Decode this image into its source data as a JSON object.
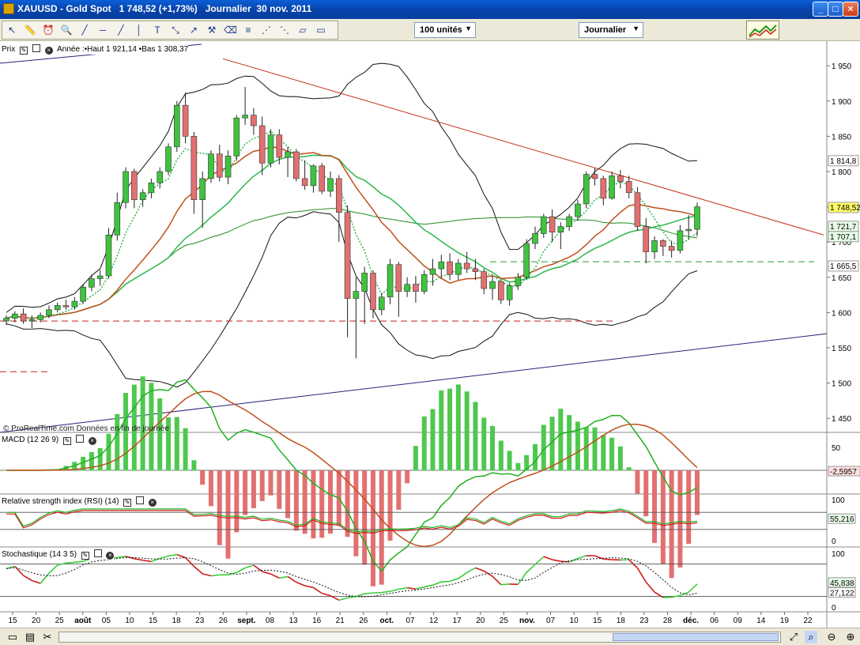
{
  "window": {
    "title": "XAUUSD - Gold Spot   1 748,52 (+1,73%)   Journalier  30 nov. 2011",
    "min_label": "_",
    "max_label": "□",
    "close_label": "×"
  },
  "toolbar": {
    "icons": [
      "cursor-icon",
      "ruler-icon",
      "alarm-icon",
      "zoom-icon",
      "line-icon",
      "horizontal-line-icon",
      "trendline-icon",
      "vertical-line-icon",
      "text-icon",
      "expand-icon",
      "arrow-icon",
      "measure-icon",
      "eraser-icon",
      "fibonacci-icon",
      "fan-icon",
      "gann-icon",
      "channel-icon",
      "rectangle-icon"
    ],
    "units_select": "100 unités",
    "period_select": "Journalier"
  },
  "panels": {
    "price": {
      "label": "Prix",
      "info": "Année :•Haut 1 921,14 •Bas 1 308,37"
    },
    "macd": {
      "label": "MACD (12 26 9)"
    },
    "rsi": {
      "label": "Relative strength index (RSI) (14)"
    },
    "stoch": {
      "label": "Stochastique (14 3 5)"
    }
  },
  "watermark": "© ProRealTime.com  Données en fin de journée",
  "axis": {
    "price_ticks": [
      "1 950",
      "1 900",
      "1 850",
      "1 800",
      "1 750",
      "1 700",
      "1 650",
      "1 600",
      "1 550",
      "1 500",
      "1 450"
    ],
    "price_tags": [
      {
        "label": "1 814,8",
        "color": "#ffffff"
      },
      {
        "label": "1 748,52",
        "color": "#ffff66"
      },
      {
        "label": "1 721,7",
        "color": "#e8ffe8"
      },
      {
        "label": "1 707,1",
        "color": "#e8ffe8"
      },
      {
        "label": "1 665,5",
        "color": "#ffffff"
      }
    ],
    "macd_ticks": [
      "50"
    ],
    "macd_tag": "-2,5957",
    "rsi_ticks": [
      "100",
      "0"
    ],
    "rsi_tag": "55,216",
    "stoch_ticks": [
      "100",
      "0"
    ],
    "stoch_tags": [
      "45,838",
      "27,122"
    ],
    "dates": [
      "15",
      "20",
      "25",
      "août",
      "05",
      "10",
      "15",
      "18",
      "23",
      "26",
      "sept.",
      "08",
      "13",
      "16",
      "21",
      "26",
      "oct.",
      "07",
      "12",
      "17",
      "20",
      "25",
      "nov.",
      "07",
      "10",
      "15",
      "18",
      "23",
      "28",
      "déc.",
      "06",
      "09",
      "14",
      "19",
      "22"
    ]
  },
  "chart_data": {
    "type": "candlestick",
    "title": "XAUUSD - Gold Spot",
    "period": "Journalier",
    "ylim": [
      1430,
      1985
    ],
    "last_close": 1748.52,
    "change_pct": "+1,73%",
    "year_high": 1921.14,
    "year_low": 1308.37,
    "candles": [
      [
        1588,
        1596,
        1582,
        1592
      ],
      [
        1592,
        1602,
        1586,
        1598
      ],
      [
        1598,
        1606,
        1584,
        1588
      ],
      [
        1588,
        1596,
        1578,
        1590
      ],
      [
        1590,
        1600,
        1586,
        1596
      ],
      [
        1596,
        1610,
        1592,
        1604
      ],
      [
        1604,
        1614,
        1600,
        1610
      ],
      [
        1610,
        1618,
        1604,
        1608
      ],
      [
        1608,
        1622,
        1604,
        1616
      ],
      [
        1616,
        1640,
        1612,
        1636
      ],
      [
        1636,
        1654,
        1630,
        1648
      ],
      [
        1648,
        1660,
        1638,
        1652
      ],
      [
        1652,
        1720,
        1648,
        1710
      ],
      [
        1710,
        1770,
        1702,
        1756
      ],
      [
        1756,
        1806,
        1748,
        1800
      ],
      [
        1800,
        1804,
        1748,
        1760
      ],
      [
        1760,
        1775,
        1750,
        1770
      ],
      [
        1770,
        1790,
        1762,
        1784
      ],
      [
        1784,
        1806,
        1776,
        1800
      ],
      [
        1800,
        1840,
        1795,
        1835
      ],
      [
        1835,
        1900,
        1828,
        1894
      ],
      [
        1894,
        1912,
        1840,
        1850
      ],
      [
        1850,
        1856,
        1740,
        1760
      ],
      [
        1760,
        1800,
        1720,
        1790
      ],
      [
        1790,
        1830,
        1784,
        1825
      ],
      [
        1825,
        1838,
        1786,
        1792
      ],
      [
        1792,
        1830,
        1782,
        1822
      ],
      [
        1822,
        1880,
        1815,
        1876
      ],
      [
        1876,
        1920,
        1866,
        1880
      ],
      [
        1880,
        1890,
        1852,
        1865
      ],
      [
        1865,
        1878,
        1795,
        1812
      ],
      [
        1812,
        1860,
        1806,
        1852
      ],
      [
        1852,
        1860,
        1810,
        1820
      ],
      [
        1820,
        1835,
        1792,
        1828
      ],
      [
        1828,
        1832,
        1786,
        1790
      ],
      [
        1790,
        1816,
        1774,
        1780
      ],
      [
        1780,
        1810,
        1770,
        1808
      ],
      [
        1808,
        1812,
        1768,
        1772
      ],
      [
        1772,
        1800,
        1764,
        1790
      ],
      [
        1790,
        1795,
        1700,
        1742
      ],
      [
        1742,
        1752,
        1565,
        1620
      ],
      [
        1620,
        1650,
        1535,
        1630
      ],
      [
        1630,
        1665,
        1584,
        1656
      ],
      [
        1656,
        1660,
        1592,
        1604
      ],
      [
        1604,
        1628,
        1596,
        1622
      ],
      [
        1622,
        1676,
        1612,
        1668
      ],
      [
        1668,
        1672,
        1594,
        1630
      ],
      [
        1630,
        1650,
        1622,
        1640
      ],
      [
        1640,
        1652,
        1614,
        1630
      ],
      [
        1630,
        1660,
        1626,
        1654
      ],
      [
        1654,
        1676,
        1638,
        1662
      ],
      [
        1662,
        1682,
        1648,
        1672
      ],
      [
        1672,
        1684,
        1646,
        1654
      ],
      [
        1654,
        1676,
        1646,
        1670
      ],
      [
        1670,
        1686,
        1656,
        1662
      ],
      [
        1662,
        1676,
        1646,
        1658
      ],
      [
        1658,
        1662,
        1626,
        1634
      ],
      [
        1634,
        1652,
        1618,
        1644
      ],
      [
        1644,
        1648,
        1612,
        1618
      ],
      [
        1618,
        1642,
        1610,
        1638
      ],
      [
        1638,
        1656,
        1632,
        1650
      ],
      [
        1650,
        1704,
        1646,
        1698
      ],
      [
        1698,
        1722,
        1690,
        1712
      ],
      [
        1712,
        1740,
        1706,
        1736
      ],
      [
        1736,
        1746,
        1700,
        1714
      ],
      [
        1714,
        1728,
        1690,
        1722
      ],
      [
        1722,
        1740,
        1716,
        1736
      ],
      [
        1736,
        1760,
        1730,
        1754
      ],
      [
        1754,
        1800,
        1748,
        1796
      ],
      [
        1796,
        1805,
        1780,
        1790
      ],
      [
        1790,
        1794,
        1752,
        1762
      ],
      [
        1762,
        1800,
        1760,
        1794
      ],
      [
        1794,
        1802,
        1776,
        1786
      ],
      [
        1786,
        1794,
        1762,
        1770
      ],
      [
        1770,
        1778,
        1716,
        1722
      ],
      [
        1722,
        1734,
        1670,
        1686
      ],
      [
        1686,
        1708,
        1676,
        1702
      ],
      [
        1702,
        1704,
        1680,
        1694
      ],
      [
        1694,
        1702,
        1678,
        1688
      ],
      [
        1688,
        1724,
        1684,
        1716
      ],
      [
        1716,
        1738,
        1704,
        1718
      ],
      [
        1718,
        1756,
        1708,
        1750
      ]
    ],
    "indicators": {
      "bollinger": "20",
      "moving_averages": [
        "short (dotted)",
        "medium",
        "long"
      ],
      "rsi_last": 55.216,
      "macd_last": -2.5957,
      "stoch_last": [
        45.838,
        27.122
      ]
    }
  }
}
